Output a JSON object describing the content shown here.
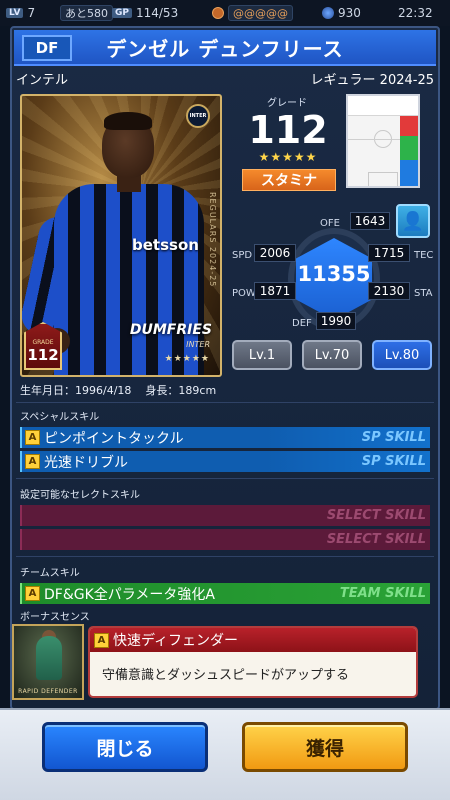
{
  "status_bar": {
    "level_badge": "LV",
    "level": "7",
    "gp_pill": "あと580",
    "gp_label": "GP",
    "gp_value": "114/53",
    "coin_pill": "@@@@@",
    "gems": "930",
    "time": "22:32"
  },
  "header": {
    "position": "DF",
    "player_name": "デンゼル デュンフリース",
    "team": "インテル",
    "card_type": "レギュラー 2024-25"
  },
  "card": {
    "club_logo": "INTER",
    "side_text": "REGULARS 2024-25",
    "sponsor": "betsson",
    "name": "DUMFRIES",
    "team": "INTER",
    "stars": "★★★★★",
    "grade_label": "GRADE",
    "grade": "112"
  },
  "grade": {
    "label": "グレード",
    "value": "112",
    "stars": "★★★★★",
    "style": "スタミナ"
  },
  "stats": {
    "ofe_label": "OFE",
    "ofe": "1643",
    "spd_label": "SPD",
    "spd": "2006",
    "tec_label": "TEC",
    "tec": "1715",
    "pow_label": "POW",
    "pow": "1871",
    "sta_label": "STA",
    "sta": "2130",
    "def_label": "DEF",
    "def": "1990",
    "total": "11355"
  },
  "levels": [
    "Lv.1",
    "Lv.70",
    "Lv.80"
  ],
  "active_level": "Lv.80",
  "profile": {
    "birthday": "生年月日：1996/4/18",
    "height": "身長：189cm"
  },
  "sections": {
    "special_skill": "スペシャルスキル",
    "select_skill": "設定可能なセレクトスキル",
    "team_skill": "チームスキル",
    "bonus_sense": "ボーナスセンス"
  },
  "special_skills": [
    {
      "rank": "A",
      "name": "ピンポイントタックル",
      "tag": "SP SKILL"
    },
    {
      "rank": "A",
      "name": "光速ドリブル",
      "tag": "SP SKILL"
    }
  ],
  "select_skills": [
    {
      "tag": "SELECT SKILL"
    },
    {
      "tag": "SELECT SKILL"
    }
  ],
  "team_skill": {
    "rank": "A",
    "name": "DF&GK全パラメータ強化A",
    "tag": "TEAM SKILL"
  },
  "bonus": {
    "image_label": "RAPID DEFENDER",
    "rank": "A",
    "title": "快速ディフェンダー",
    "description": "守備意識とダッシュスピードがアップする"
  },
  "buttons": {
    "close": "閉じる",
    "acquire": "獲得"
  },
  "colors": {
    "title_blue": "#2e73e6",
    "style_orange": "#f58a2c",
    "sp_skill_blue": "#0f5db0",
    "select_skill_maroon": "#5c1a3a",
    "team_skill_green": "#1e8c2a",
    "bonus_red": "#b8212a"
  }
}
